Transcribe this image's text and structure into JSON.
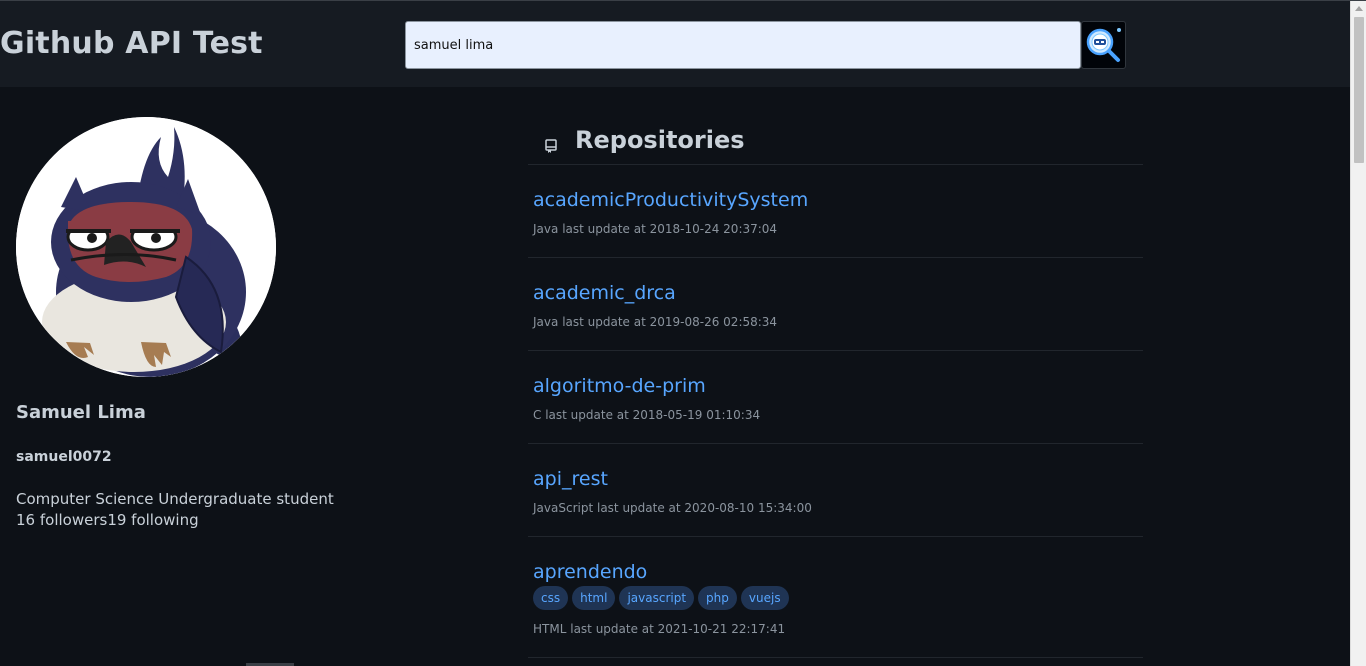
{
  "header": {
    "title": "Github API Test",
    "search_value": "samuel lima",
    "search_icon": "search-magnifier-icon"
  },
  "profile": {
    "name": "Samuel Lima",
    "login": "samuel0072",
    "bio": "Computer Science Undergraduate student",
    "followers": "16 followers",
    "following": "19 following"
  },
  "repositories": {
    "heading": "Repositories",
    "icon": "repo-icon",
    "items": [
      {
        "name": "academicProductivitySystem",
        "language": "Java",
        "updated": "last update at 2018-10-24 20:37:04",
        "topics": []
      },
      {
        "name": "academic_drca",
        "language": "Java",
        "updated": "last update at 2019-08-26 02:58:34",
        "topics": []
      },
      {
        "name": "algoritmo-de-prim",
        "language": "C",
        "updated": "last update at 2018-05-19 01:10:34",
        "topics": []
      },
      {
        "name": "api_rest",
        "language": "JavaScript",
        "updated": "last update at 2020-08-10 15:34:00",
        "topics": []
      },
      {
        "name": "aprendendo",
        "language": "HTML",
        "updated": "last update at 2021-10-21 22:17:41",
        "topics": [
          "css",
          "html",
          "javascript",
          "php",
          "vuejs"
        ]
      }
    ]
  },
  "colors": {
    "background": "#0d1117",
    "header_bg": "#161b22",
    "link": "#58a6ff",
    "topic_bg": "#1f3454",
    "muted_text": "#8b949e"
  }
}
